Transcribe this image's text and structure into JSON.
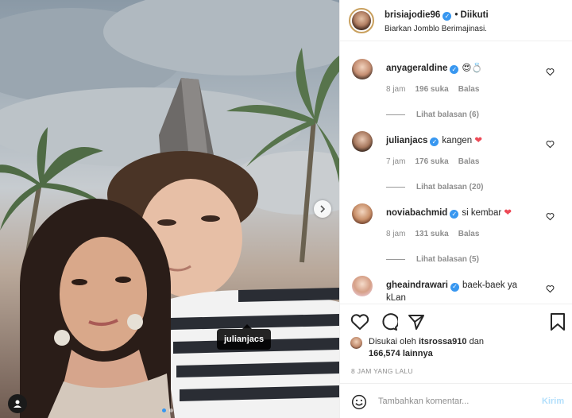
{
  "post": {
    "author": "brisiajodie96",
    "follow_status": "• Diikuti",
    "subtitle": "Biarkan Jomblo Berimajinasi.",
    "photo_tag": "julianjacs",
    "carousel": {
      "count": 2,
      "active": 1
    }
  },
  "comments": [
    {
      "user": "anyageraldine",
      "text": "😍💍",
      "heart": "",
      "time": "8 jam",
      "likes": "196 suka",
      "reply": "Balas",
      "replies": "Lihat balasan (6)"
    },
    {
      "user": "julianjacs",
      "text": "kangen",
      "heart": "❤",
      "time": "7 jam",
      "likes": "176 suka",
      "reply": "Balas",
      "replies": "Lihat balasan (20)"
    },
    {
      "user": "noviabachmid",
      "text": "si kembar",
      "heart": "❤",
      "time": "8 jam",
      "likes": "131 suka",
      "reply": "Balas",
      "replies": "Lihat balasan (5)"
    },
    {
      "user": "gheaindrawari",
      "text": "baek-baek ya kLan",
      "heart": "",
      "time": "",
      "likes": "",
      "reply": "",
      "replies": ""
    }
  ],
  "likes": {
    "prefix": "Disukai oleh",
    "user": "itsrossa910",
    "conj": "dan",
    "count": "166,574 lainnya"
  },
  "time_ago": "8 JAM YANG LALU",
  "composer": {
    "placeholder": "Tambahkan komentar...",
    "post_label": "Kirim"
  },
  "icons": [
    "heart-icon",
    "comment-icon",
    "share-icon",
    "bookmark-icon",
    "smile-icon",
    "chevron-right-icon",
    "user-icon",
    "verified-icon"
  ],
  "colors": {
    "accent": "#3897f0",
    "post_disabled": "#b2dffc",
    "meta_gray": "#8e8e8e",
    "heart_red": "#ed4956"
  }
}
